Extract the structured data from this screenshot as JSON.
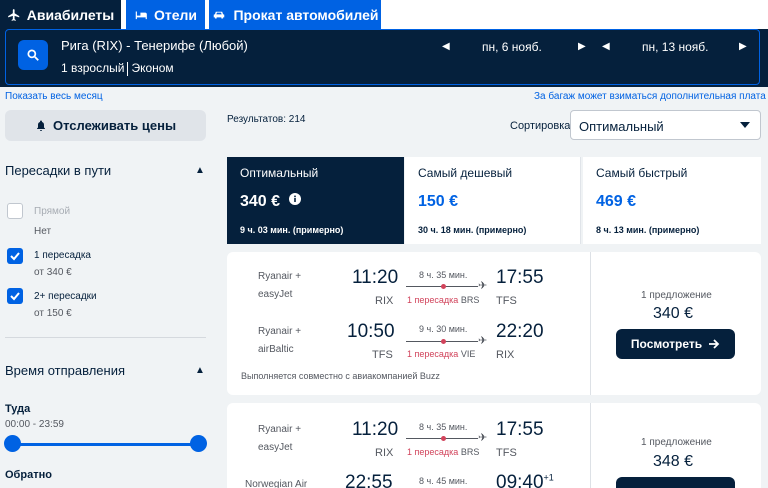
{
  "tabs": [
    {
      "label": "Авиабилеты",
      "icon": "plane-icon"
    },
    {
      "label": "Отели",
      "icon": "bed-icon"
    },
    {
      "label": "Прокат автомобилей",
      "icon": "car-icon"
    }
  ],
  "search": {
    "route": "Рига (RIX) - Тенерифе (Любой)",
    "passengers": "1 взрослый",
    "cabin": "Эконом",
    "depart_date": "пн, 6 нояб.",
    "return_date": "пн, 13 нояб."
  },
  "links": {
    "whole_month": "Показать весь месяц",
    "baggage": "За багаж может взиматься дополнительная плата"
  },
  "track_prices": "Отслеживать цены",
  "filters": {
    "stops_title": "Пересадки в пути",
    "options": [
      {
        "label": "Прямой",
        "sub": "Нет",
        "checked": false
      },
      {
        "label": "1 пересадка",
        "sub": "от 340 €",
        "checked": true
      },
      {
        "label": "2+ пересадки",
        "sub": "от 150 €",
        "checked": true
      }
    ],
    "time_title": "Время отправления",
    "outbound_label": "Туда",
    "outbound_range": "00:00 - 23:59",
    "return_label": "Обратно"
  },
  "results_count": "Результатов: 214",
  "sort": {
    "label": "Сортировка",
    "value": "Оптимальный"
  },
  "sort_tabs": [
    {
      "title": "Оптимальный",
      "price": "340 €",
      "duration": "9 ч. 03 мин. (примерно)"
    },
    {
      "title": "Самый дешевый",
      "price": "150 €",
      "duration": "30 ч. 18 мин. (примерно)"
    },
    {
      "title": "Самый быстрый",
      "price": "469 €",
      "duration": "8 ч. 13 мин. (примерно)"
    }
  ],
  "cards": [
    {
      "legs": [
        {
          "airline1": "Ryanair +",
          "airline2": "easyJet",
          "dep": "11:20",
          "arr": "17:55",
          "from": "RIX",
          "to": "TFS",
          "duration": "8 ч. 35 мин.",
          "stops": "1 пересадка",
          "via": "BRS"
        },
        {
          "airline1": "Ryanair +",
          "airline2": "airBaltic",
          "dep": "10:50",
          "arr": "22:20",
          "from": "TFS",
          "to": "RIX",
          "duration": "9 ч. 30 мин.",
          "stops": "1 пересадка",
          "via": "VIE"
        }
      ],
      "note": "Выполняется совместно с авиакомпанией Buzz",
      "offers": "1 предложение",
      "price": "340 €",
      "button": "Посмотреть"
    },
    {
      "legs": [
        {
          "airline1": "Ryanair +",
          "airline2": "easyJet",
          "dep": "11:20",
          "arr": "17:55",
          "from": "RIX",
          "to": "TFS",
          "duration": "8 ч. 35 мин.",
          "stops": "1 пересадка",
          "via": "BRS"
        },
        {
          "airline1": "Norwegian Air",
          "airline2": "",
          "dep": "22:55",
          "arr": "09:40",
          "arr_sup": "+1",
          "from": "",
          "to": "",
          "duration": "8 ч. 45 мин.",
          "stops": "",
          "via": ""
        }
      ],
      "offers": "1 предложение",
      "price": "348 €",
      "button": ""
    }
  ]
}
